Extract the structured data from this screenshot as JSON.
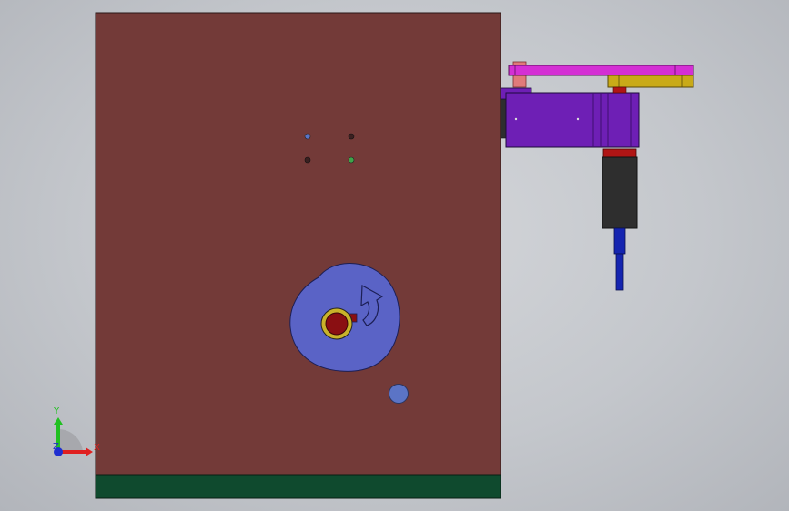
{
  "viewport": {
    "background": "#c8cacf"
  },
  "triad": {
    "labels": {
      "x": "X",
      "y": "Y",
      "z": "Z"
    },
    "colors": {
      "x": "#e02020",
      "y": "#20c020",
      "z": "#1f2fd0"
    }
  },
  "model": {
    "colors": {
      "plate": "#733a38",
      "base_strip": "#0f4a2e",
      "cam": "#5a63c6",
      "bore_ring": "#c9b32a",
      "bore_core": "#8a0f12",
      "motor_housing": "#6e1fb5",
      "top_arm": "#d42fd4",
      "gold_link": "#c9aa18",
      "pink_post": "#e07a7a",
      "dark_block": "#2e2e2e",
      "red_ring": "#b01515",
      "blue_rod": "#1424b0",
      "hole_blue": "#5b74c6",
      "hole_green": "#3ea54a",
      "hole_dark": "#3a2020"
    }
  }
}
